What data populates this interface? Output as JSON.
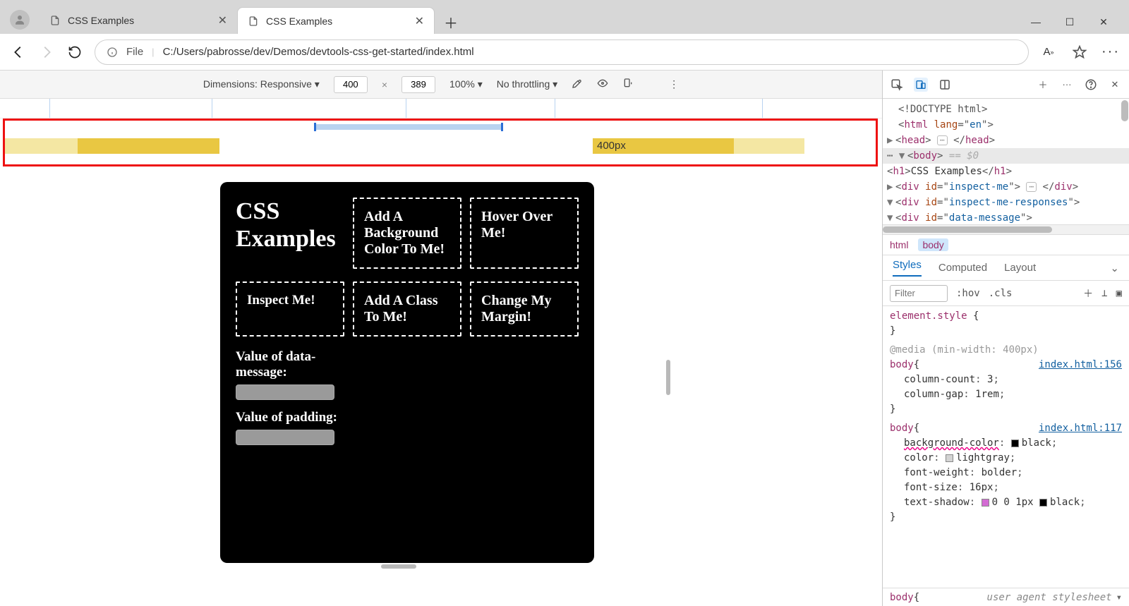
{
  "browser": {
    "tabs": [
      {
        "title": "CSS Examples",
        "active": false
      },
      {
        "title": "CSS Examples",
        "active": true
      }
    ],
    "address": {
      "scheme_label": "File",
      "url": "C:/Users/pabrosse/dev/Demos/devtools-css-get-started/index.html"
    }
  },
  "device_toolbar": {
    "dimensions_label": "Dimensions: Responsive",
    "width": "400",
    "height": "389",
    "zoom": "100%",
    "throttling": "No throttling"
  },
  "breakpoint_label": "400px",
  "page": {
    "heading": "CSS Examples",
    "boxes": {
      "bg": "Add A Background Color To Me!",
      "hover": "Hover Over Me!",
      "inspect": "Inspect Me!",
      "cls": "Add A Class To Me!",
      "margin": "Change My Margin!"
    },
    "label_data_message": "Value of data-message:",
    "label_padding": "Value of padding:"
  },
  "dom": {
    "doctype": "<!DOCTYPE html>",
    "html_open": {
      "tag": "html",
      "attr": "lang",
      "val": "en"
    },
    "head": "head",
    "body": "body",
    "body_ghost": "== $0",
    "h1_text": "CSS Examples",
    "div_inspect": {
      "attr": "id",
      "val": "inspect-me"
    },
    "div_resp": {
      "attr": "id",
      "val": "inspect-me-responses"
    },
    "div_msg": {
      "attr": "id",
      "val": "data-message"
    }
  },
  "breadcrumb": {
    "a": "html",
    "b": "body"
  },
  "styles": {
    "tab_styles": "Styles",
    "tab_computed": "Computed",
    "tab_layout": "Layout",
    "filter_placeholder": "Filter",
    "hov": ":hov",
    "cls": ".cls",
    "element_style": "element.style",
    "media_rule": "@media (min-width: 400px)",
    "rule1": {
      "selector": "body",
      "source": "index.html:156",
      "decls": [
        {
          "prop": "column-count",
          "val": "3"
        },
        {
          "prop": "column-gap",
          "val": "1rem"
        }
      ]
    },
    "rule2": {
      "selector": "body",
      "source": "index.html:117",
      "decls": [
        {
          "prop": "background-color",
          "val": "black",
          "swatch": "#000000",
          "wavy": true
        },
        {
          "prop": "color",
          "val": "lightgray",
          "swatch": "#d3d3d3"
        },
        {
          "prop": "font-weight",
          "val": "bolder"
        },
        {
          "prop": "font-size",
          "val": "16px"
        },
        {
          "prop": "text-shadow",
          "val": "0 0 1px ",
          "swatch": "#d36bd3",
          "swatch2": "#000000",
          "tail": "black"
        }
      ]
    },
    "ua_selector": "body",
    "ua_label": "user agent stylesheet"
  }
}
